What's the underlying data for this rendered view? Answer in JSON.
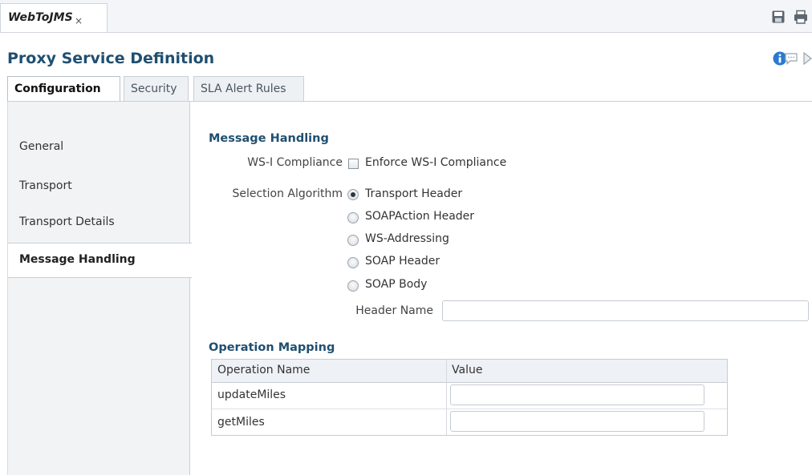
{
  "editor_tab": {
    "title": "WebToJMS",
    "close": "×"
  },
  "page_title": "Proxy Service Definition",
  "config_tabs": [
    {
      "label": "Configuration",
      "active": true
    },
    {
      "label": "Security",
      "active": false
    },
    {
      "label": "SLA Alert Rules",
      "active": false
    }
  ],
  "left_nav": [
    {
      "label": "General",
      "active": false
    },
    {
      "label": "Transport",
      "active": false
    },
    {
      "label": "Transport Details",
      "active": false
    },
    {
      "label": "Message Handling",
      "active": true
    }
  ],
  "message_handling": {
    "title": "Message Handling",
    "ws_i_label": "WS-I Compliance",
    "ws_i_option": "Enforce WS-I Compliance",
    "ws_i_checked": false,
    "selection_label": "Selection Algorithm",
    "selection_options": [
      "Transport Header",
      "SOAPAction Header",
      "WS-Addressing",
      "SOAP Header",
      "SOAP Body"
    ],
    "selected_option": "Transport Header",
    "header_name_label": "Header Name",
    "header_name_value": ""
  },
  "operation_mapping": {
    "title": "Operation Mapping",
    "columns": [
      "Operation Name",
      "Value"
    ],
    "rows": [
      {
        "operation": "updateMiles",
        "value": ""
      },
      {
        "operation": "getMiles",
        "value": ""
      }
    ]
  },
  "colors": {
    "heading": "#1f4f70",
    "info_icon": "#2a7ad0"
  },
  "icons": [
    "save-icon",
    "print-icon",
    "info-icon",
    "comment-icon",
    "play-icon"
  ]
}
